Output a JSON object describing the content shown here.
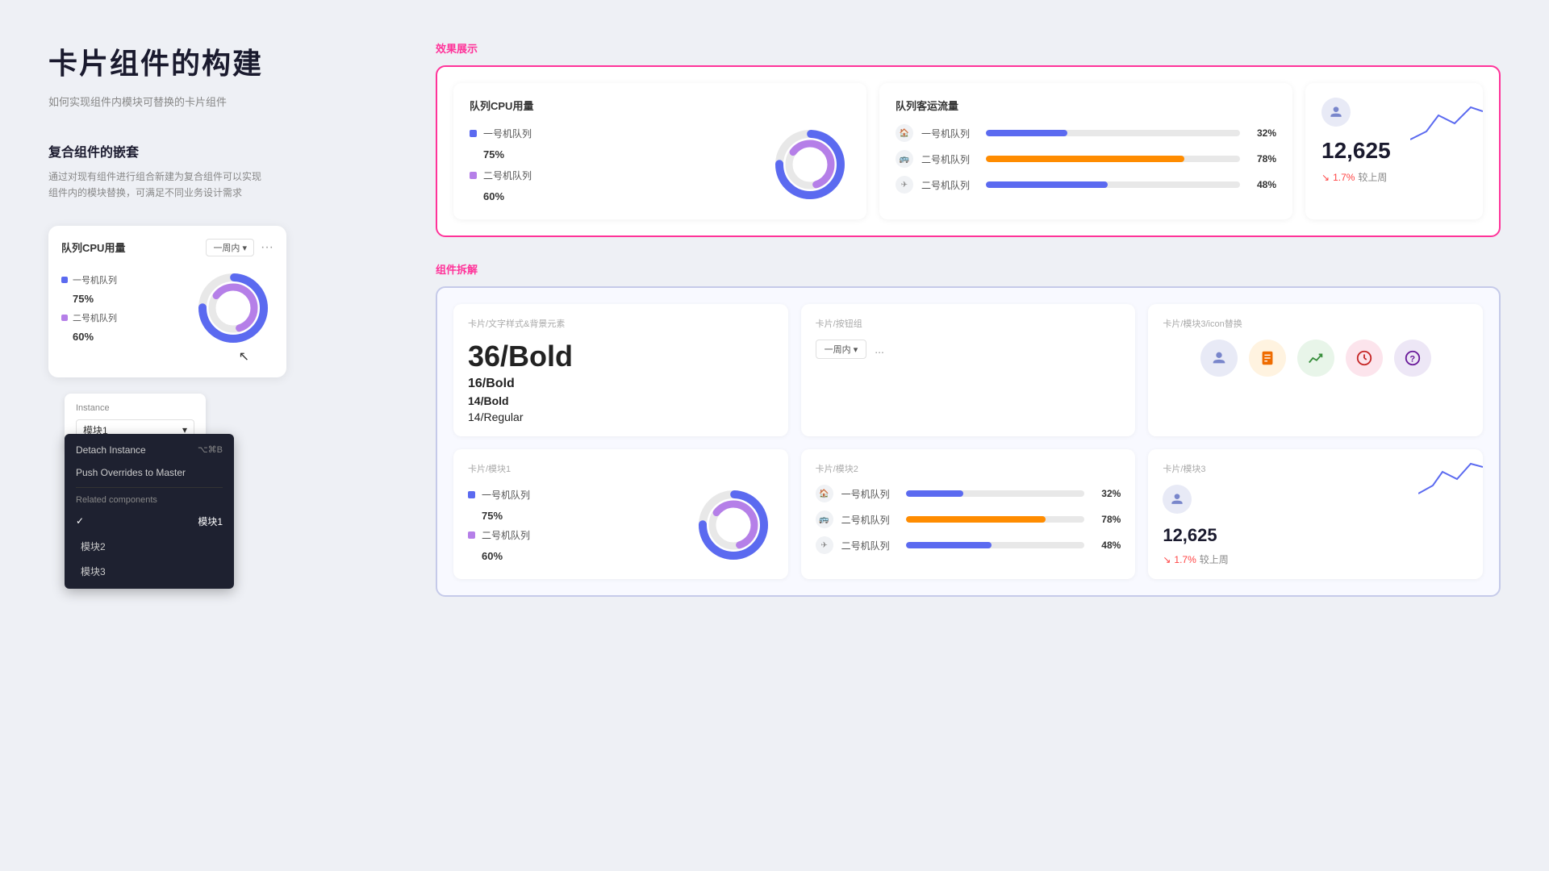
{
  "page": {
    "title": "卡片组件的构建",
    "subtitle": "如何实现组件内模块可替换的卡片组件",
    "section1_heading": "复合组件的嵌套",
    "section1_desc": "通过对现有组件进行组合新建为复合组件可以实现\n组件内的模块替换，可满足不同业务设计需求",
    "effect_label": "效果展示",
    "decompose_label": "组件拆解"
  },
  "mini_card": {
    "title": "队列CPU用量",
    "dropdown": "一周内",
    "legend": [
      {
        "color": "#5b6af0",
        "label": "一号机队列",
        "value": "75%"
      },
      {
        "color": "#b57fe8",
        "label": "二号机队列",
        "value": "60%"
      }
    ]
  },
  "instance_panel": {
    "label": "Instance",
    "current": "模块1",
    "menu": {
      "detach": "Detach Instance",
      "detach_shortcut": "⌥⌘B",
      "push": "Push Overrides to Master",
      "related_section": "Related components",
      "items": [
        "模块1",
        "模块2",
        "模块3"
      ],
      "checked": "模块1"
    }
  },
  "cpu_card": {
    "title": "队列CPU用量",
    "legend": [
      {
        "color": "#5b6af0",
        "label": "一号机队列",
        "value": "75%"
      },
      {
        "color": "#b57fe8",
        "label": "二号机队列",
        "value": "60%"
      }
    ],
    "donut": {
      "outer_color": "#5b6af0",
      "inner_color": "#b57fe8",
      "outer_pct": 75,
      "inner_pct": 60
    }
  },
  "traffic_card": {
    "title": "队列客运流量",
    "rows": [
      {
        "icon": "🏠",
        "label": "一号机队列",
        "pct": 32,
        "color": "#5b6af0"
      },
      {
        "icon": "🚌",
        "label": "二号机队列",
        "pct": 78,
        "color": "#ff8c00"
      },
      {
        "icon": "✈",
        "label": "二号机队列",
        "pct": 48,
        "color": "#5b6af0"
      }
    ]
  },
  "stat_card": {
    "icon_bg": "#e8eaf6",
    "icon_color": "#7986cb",
    "number": "12,625",
    "change": "1.7%",
    "change_label": "较上周",
    "change_dir": "down"
  },
  "decompose": {
    "text_card": {
      "label": "卡片/文字样式&背景元素",
      "styles": [
        "36/Bold",
        "16/Bold",
        "14/Bold",
        "14/Regular"
      ]
    },
    "btn_card": {
      "label": "卡片/按钮组",
      "btn_label": "一周内",
      "dots": "..."
    },
    "icon_card": {
      "label": "卡片/模块3/icon替换",
      "icons": [
        {
          "bg": "#e8eaf6",
          "color": "#7986cb",
          "symbol": "👤"
        },
        {
          "bg": "#fff3e0",
          "color": "#ef6c00",
          "symbol": "📋"
        },
        {
          "bg": "#e8f5e9",
          "color": "#388e3c",
          "symbol": "📈"
        },
        {
          "bg": "#fce4ec",
          "color": "#c62828",
          "symbol": "🕐"
        },
        {
          "bg": "#ede7f6",
          "color": "#6a1b9a",
          "symbol": "❓"
        }
      ]
    },
    "module1": {
      "label": "卡片/模块1",
      "legend": [
        {
          "color": "#5b6af0",
          "label": "一号机队列",
          "value": "75%"
        },
        {
          "color": "#b57fe8",
          "label": "二号机队列",
          "value": "60%"
        }
      ]
    },
    "module2": {
      "label": "卡片/模块2",
      "rows": [
        {
          "icon": "🏠",
          "label": "一号机队列",
          "pct": 32,
          "color": "#5b6af0"
        },
        {
          "icon": "🚌",
          "label": "二号机队列",
          "pct": 78,
          "color": "#ff8c00"
        },
        {
          "icon": "✈",
          "label": "二号机队列",
          "pct": 48,
          "color": "#5b6af0"
        }
      ]
    },
    "module3": {
      "label": "卡片/模块3",
      "number": "12,625",
      "change": "1.7%",
      "change_label": "较上周"
    }
  },
  "colors": {
    "accent_pink": "#ff3399",
    "accent_blue": "#5b6af0",
    "accent_purple": "#b57fe8",
    "accent_orange": "#ff8c00",
    "bg_light": "#eef0f5",
    "card_white": "#ffffff"
  }
}
